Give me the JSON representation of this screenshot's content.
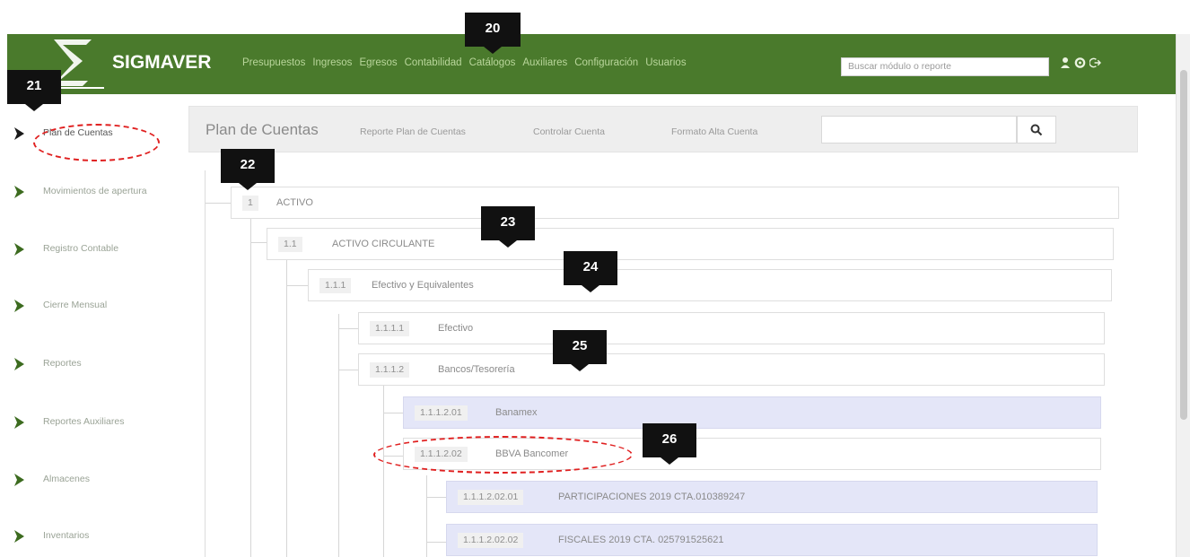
{
  "app": {
    "title": "SIGMAVER"
  },
  "topbar": {
    "menu": [
      "Presupuestos",
      "Ingresos",
      "Egresos",
      "Contabilidad",
      "Catálogos",
      "Auxiliares",
      "Configuración",
      "Usuarios"
    ],
    "search_placeholder": "Buscar módulo o reporte",
    "icons": [
      "user-icon",
      "settings-icon",
      "logout-icon"
    ]
  },
  "sidebar": {
    "items": [
      {
        "label": "Plan de Cuentas",
        "active": true
      },
      {
        "label": "Movimientos de apertura"
      },
      {
        "label": "Registro Contable"
      },
      {
        "label": "Cierre Mensual"
      },
      {
        "label": "Reportes"
      },
      {
        "label": "Reportes Auxiliares"
      },
      {
        "label": "Almacenes"
      },
      {
        "label": "Inventarios"
      }
    ]
  },
  "toolbar": {
    "title": "Plan de Cuentas",
    "links": [
      "Reporte Plan de Cuentas",
      "Controlar Cuenta",
      "Formato Alta Cuenta"
    ],
    "search_value": "",
    "search_button_icon": "search-icon"
  },
  "tree": [
    {
      "code": "1",
      "label": "ACTIVO"
    },
    {
      "code": "1.1",
      "label": "ACTIVO CIRCULANTE"
    },
    {
      "code": "1.1.1",
      "label": "Efectivo y Equivalentes"
    },
    {
      "code": "1.1.1.1",
      "label": "Efectivo"
    },
    {
      "code": "1.1.1.2",
      "label": "Bancos/Tesorería"
    },
    {
      "code": "1.1.1.2.01",
      "label": "Banamex"
    },
    {
      "code": "1.1.1.2.02",
      "label": "BBVA Bancomer"
    },
    {
      "code": "1.1.1.2.02.01",
      "label": "PARTICIPACIONES 2019 CTA.010389247"
    },
    {
      "code": "1.1.1.2.02.02",
      "label": "FISCALES 2019 CTA. 025791525621"
    }
  ],
  "callouts": [
    "20",
    "21",
    "22",
    "23",
    "24",
    "25",
    "26"
  ],
  "colors": {
    "navbar": "#4a7a2c",
    "menu_text": "#b9d69b",
    "highlight_row": "#e4e6f8",
    "callout": "#111111",
    "annotation": "#e02020"
  }
}
